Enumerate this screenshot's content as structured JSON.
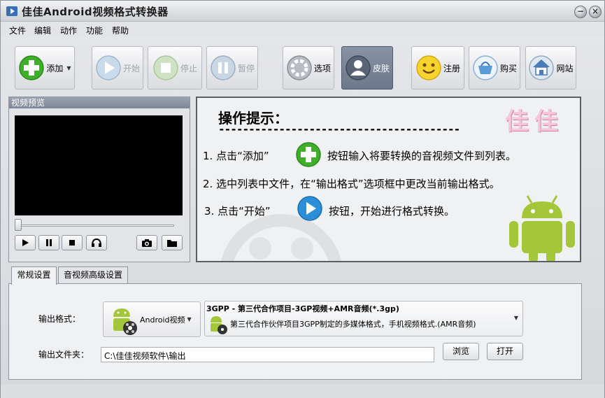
{
  "window": {
    "title": "佳佳Android视频格式转换器",
    "controls": {
      "minimize": "−",
      "close": "×"
    }
  },
  "menu": [
    "文件",
    "编辑",
    "动作",
    "功能",
    "帮助"
  ],
  "toolbar": {
    "add": "添加",
    "start": "开始",
    "stop": "停止",
    "pause": "暂停",
    "options": "选项",
    "skin": "皮肤",
    "register": "注册",
    "buy": "购买",
    "website": "网站"
  },
  "preview": {
    "header": "视频预览",
    "seek_position": 0
  },
  "tips": {
    "title": "操作提示：",
    "dashes": "----------------------------------------",
    "brand": "佳佳",
    "line1_a": "1. 点击“添加”",
    "line1_b": "按钮输入将要转换的音视频文件到列表。",
    "line2": "2. 选中列表中文件，在“输出格式”选项框中更改当前输出格式。",
    "line3_a": "3. 点击“开始”",
    "line3_b": "按钮，开始进行格式转换。"
  },
  "tabs": [
    "常规设置",
    "音视频高级设置"
  ],
  "settings": {
    "output_format_label": "输出格式：",
    "format_button": "Android视频",
    "format_title": "3GPP - 第三代合作项目-3GP视频+AMR音频(*.3gp)",
    "format_desc": "第三代合作伙伴项目3GPP制定的多媒体格式，手机视频格式.(AMR音频)",
    "output_folder_label": "输出文件夹：",
    "output_folder": "C:\\佳佳视频软件\\输出",
    "browse": "浏览",
    "open": "打开"
  },
  "colors": {
    "accent_green": "#3fae2a",
    "accent_blue": "#2a8fd8",
    "android_green": "#a4c639",
    "skin_pressed": "#6c788b"
  },
  "icons": {
    "add": "plus-icon",
    "start": "play-icon",
    "stop": "stop-icon",
    "pause": "pause-icon",
    "options": "gear-icon",
    "skin": "user-icon",
    "register": "smiley-icon",
    "buy": "basket-icon",
    "website": "home-icon"
  }
}
